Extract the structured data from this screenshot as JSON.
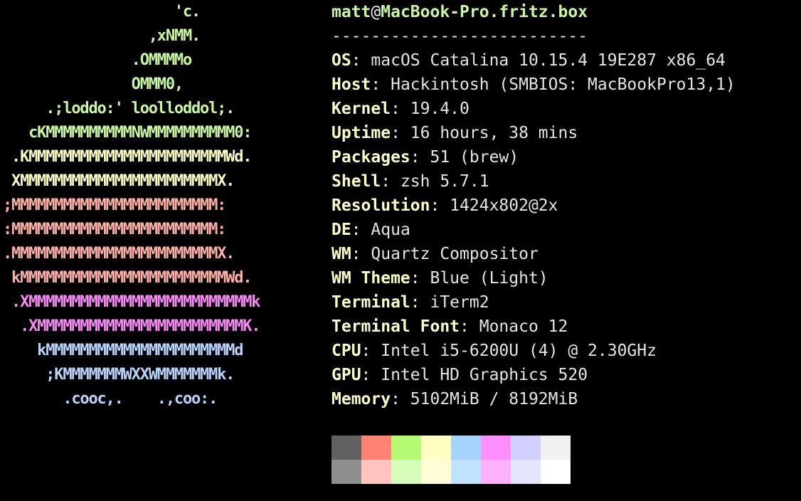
{
  "logo": {
    "lines": [
      {
        "text": "                    'c.",
        "color": "#c8f7a4"
      },
      {
        "text": "                 ,xNMM.",
        "color": "#c8f7a4"
      },
      {
        "text": "               .OMMMMo",
        "color": "#c8f7a4"
      },
      {
        "text": "               OMMM0,",
        "color": "#c8f7a4"
      },
      {
        "text": "     .;loddo:' loolloddol;.",
        "color": "#c8f7a4"
      },
      {
        "text": "   cKMMMMMMMMMMNWMMMMMMMMMM0:",
        "color": "#c8f7a4"
      },
      {
        "text": " .KMMMMMMMMMMMMMMMMMMMMMMMWd.",
        "color": "#fbfcc4"
      },
      {
        "text": " XMMMMMMMMMMMMMMMMMMMMMMMX.",
        "color": "#fbfcc4"
      },
      {
        "text": ";MMMMMMMMMMMMMMMMMMMMMMMM:",
        "color": "#ffb1a8"
      },
      {
        "text": ":MMMMMMMMMMMMMMMMMMMMMMMM:",
        "color": "#ffb1a8"
      },
      {
        "text": ".MMMMMMMMMMMMMMMMMMMMMMMMX.",
        "color": "#ffb1a8"
      },
      {
        "text": " kMMMMMMMMMMMMMMMMMMMMMMMMWd.",
        "color": "#ffb1a8"
      },
      {
        "text": " .XMMMMMMMMMMMMMMMMMMMMMMMMMMk",
        "color": "#f88af8"
      },
      {
        "text": "  .XMMMMMMMMMMMMMMMMMMMMMMMMK.",
        "color": "#f88af8"
      },
      {
        "text": "    kMMMMMMMMMMMMMMMMMMMMMMd",
        "color": "#b8d4fc"
      },
      {
        "text": "     ;KMMMMMMMWXXWMMMMMMMk.",
        "color": "#b8d4fc"
      },
      {
        "text": "       .cooc,.    .,coo:.",
        "color": "#b8d4fc"
      }
    ]
  },
  "title": {
    "user": "matt",
    "at": "@",
    "host": "MacBook-Pro.fritz.box"
  },
  "separator": "--------------------------",
  "info": [
    {
      "key": "OS",
      "value": "macOS Catalina 10.15.4 19E287 x86_64"
    },
    {
      "key": "Host",
      "value": "Hackintosh (SMBIOS: MacBookPro13,1)"
    },
    {
      "key": "Kernel",
      "value": "19.4.0"
    },
    {
      "key": "Uptime",
      "value": "16 hours, 38 mins"
    },
    {
      "key": "Packages",
      "value": "51 (brew)"
    },
    {
      "key": "Shell",
      "value": "zsh 5.7.1"
    },
    {
      "key": "Resolution",
      "value": "1424x802@2x"
    },
    {
      "key": "DE",
      "value": "Aqua"
    },
    {
      "key": "WM",
      "value": "Quartz Compositor"
    },
    {
      "key": "WM Theme",
      "value": "Blue (Light)"
    },
    {
      "key": "Terminal",
      "value": "iTerm2"
    },
    {
      "key": "Terminal Font",
      "value": "Monaco 12"
    },
    {
      "key": "CPU",
      "value": "Intel i5-6200U (4) @ 2.30GHz"
    },
    {
      "key": "GPU",
      "value": "Intel HD Graphics 520"
    },
    {
      "key": "Memory",
      "value": "5102MiB / 8192MiB"
    }
  ],
  "palette": {
    "normal": [
      "#616161",
      "#ff8272",
      "#b4fa72",
      "#fefdc2",
      "#a5d5fe",
      "#ff8ffd",
      "#d0d1fe",
      "#f1f1f1"
    ],
    "bright": [
      "#8e8e8e",
      "#ffc4bd",
      "#d6fcb9",
      "#fefdd5",
      "#c1e3fe",
      "#ffb1fe",
      "#e5e6fe",
      "#feffff"
    ]
  }
}
